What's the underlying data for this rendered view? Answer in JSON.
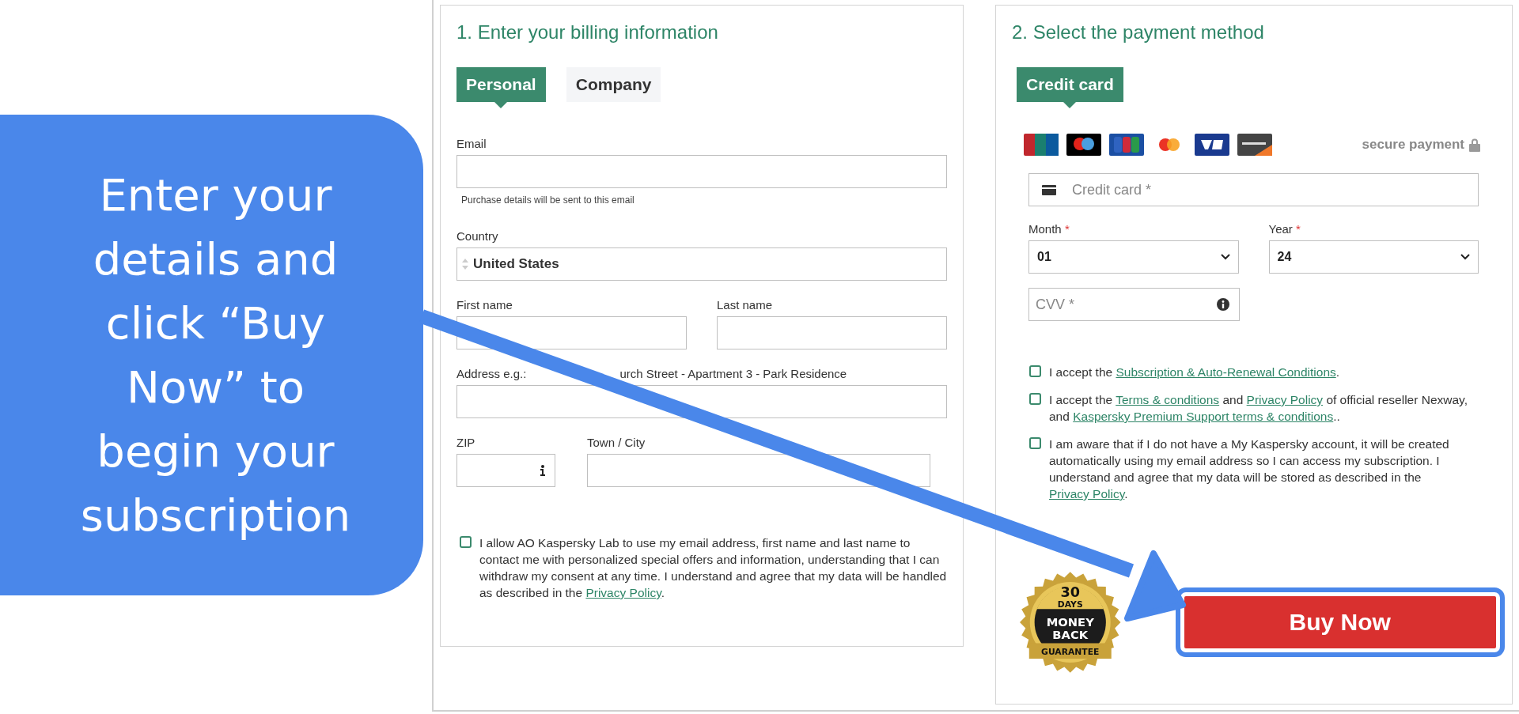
{
  "callout": {
    "lines": [
      "Enter your",
      "details and",
      "click “Buy",
      "Now” to",
      "begin your",
      "subscription"
    ]
  },
  "billing": {
    "title": "1. Enter your billing information",
    "tabs": [
      {
        "label": "Personal",
        "selected": true
      },
      {
        "label": "Company",
        "selected": false
      }
    ],
    "email": {
      "label": "Email",
      "hint": "Purchase details will be sent to this email"
    },
    "country": {
      "label": "Country",
      "value": "United States"
    },
    "first_name": {
      "label": "First name"
    },
    "last_name": {
      "label": "Last name"
    },
    "address": {
      "label_start": "Address e.g.:",
      "label_end": "urch Street - Apartment 3 - Park Residence"
    },
    "zip": {
      "label": "ZIP"
    },
    "city": {
      "label": "Town / City"
    },
    "consent": {
      "checked": false,
      "parts": [
        {
          "text": "I allow AO Kaspersky Lab to use my email address, first name and last name to contact me with personalized special offers and information, understanding that I can withdraw my consent at any time. I understand and agree that my data will be handled as described in the "
        },
        {
          "link": "Privacy Policy"
        },
        {
          "text": "."
        }
      ]
    }
  },
  "payment": {
    "title": "2. Select the payment method",
    "tabs": [
      {
        "label": "Credit card",
        "selected": true
      }
    ],
    "secure": "secure payment",
    "card_number": {
      "placeholder": "Credit card *"
    },
    "month": {
      "label": "Month",
      "required_mark": "*",
      "value": "01"
    },
    "year": {
      "label": "Year",
      "required_mark": "*",
      "value": "24"
    },
    "cvv": {
      "placeholder": "CVV *"
    },
    "agreements": [
      {
        "checked": false,
        "parts": [
          {
            "text": "I accept the "
          },
          {
            "link": "Subscription & Auto-Renewal Conditions"
          },
          {
            "text": "."
          }
        ]
      },
      {
        "checked": false,
        "parts": [
          {
            "text": "I accept the "
          },
          {
            "link": "Terms & conditions"
          },
          {
            "text": " and "
          },
          {
            "link": "Privacy Policy"
          },
          {
            "text": " of official reseller Nexway, and "
          },
          {
            "link": "Kaspersky Premium Support terms & conditions"
          },
          {
            "text": ".."
          }
        ]
      },
      {
        "checked": false,
        "parts": [
          {
            "text": "I am aware that if I do not have a My Kaspersky account, it will be created automatically using my email address so I can access my subscription. I understand and agree that my data will be stored as described in the "
          },
          {
            "link": "Privacy Policy"
          },
          {
            "text": "."
          }
        ]
      }
    ],
    "badge": {
      "lines": [
        "30",
        "DAYS",
        "MONEY",
        "BACK",
        "GUARANTEE"
      ]
    },
    "buy_button": "Buy Now"
  }
}
